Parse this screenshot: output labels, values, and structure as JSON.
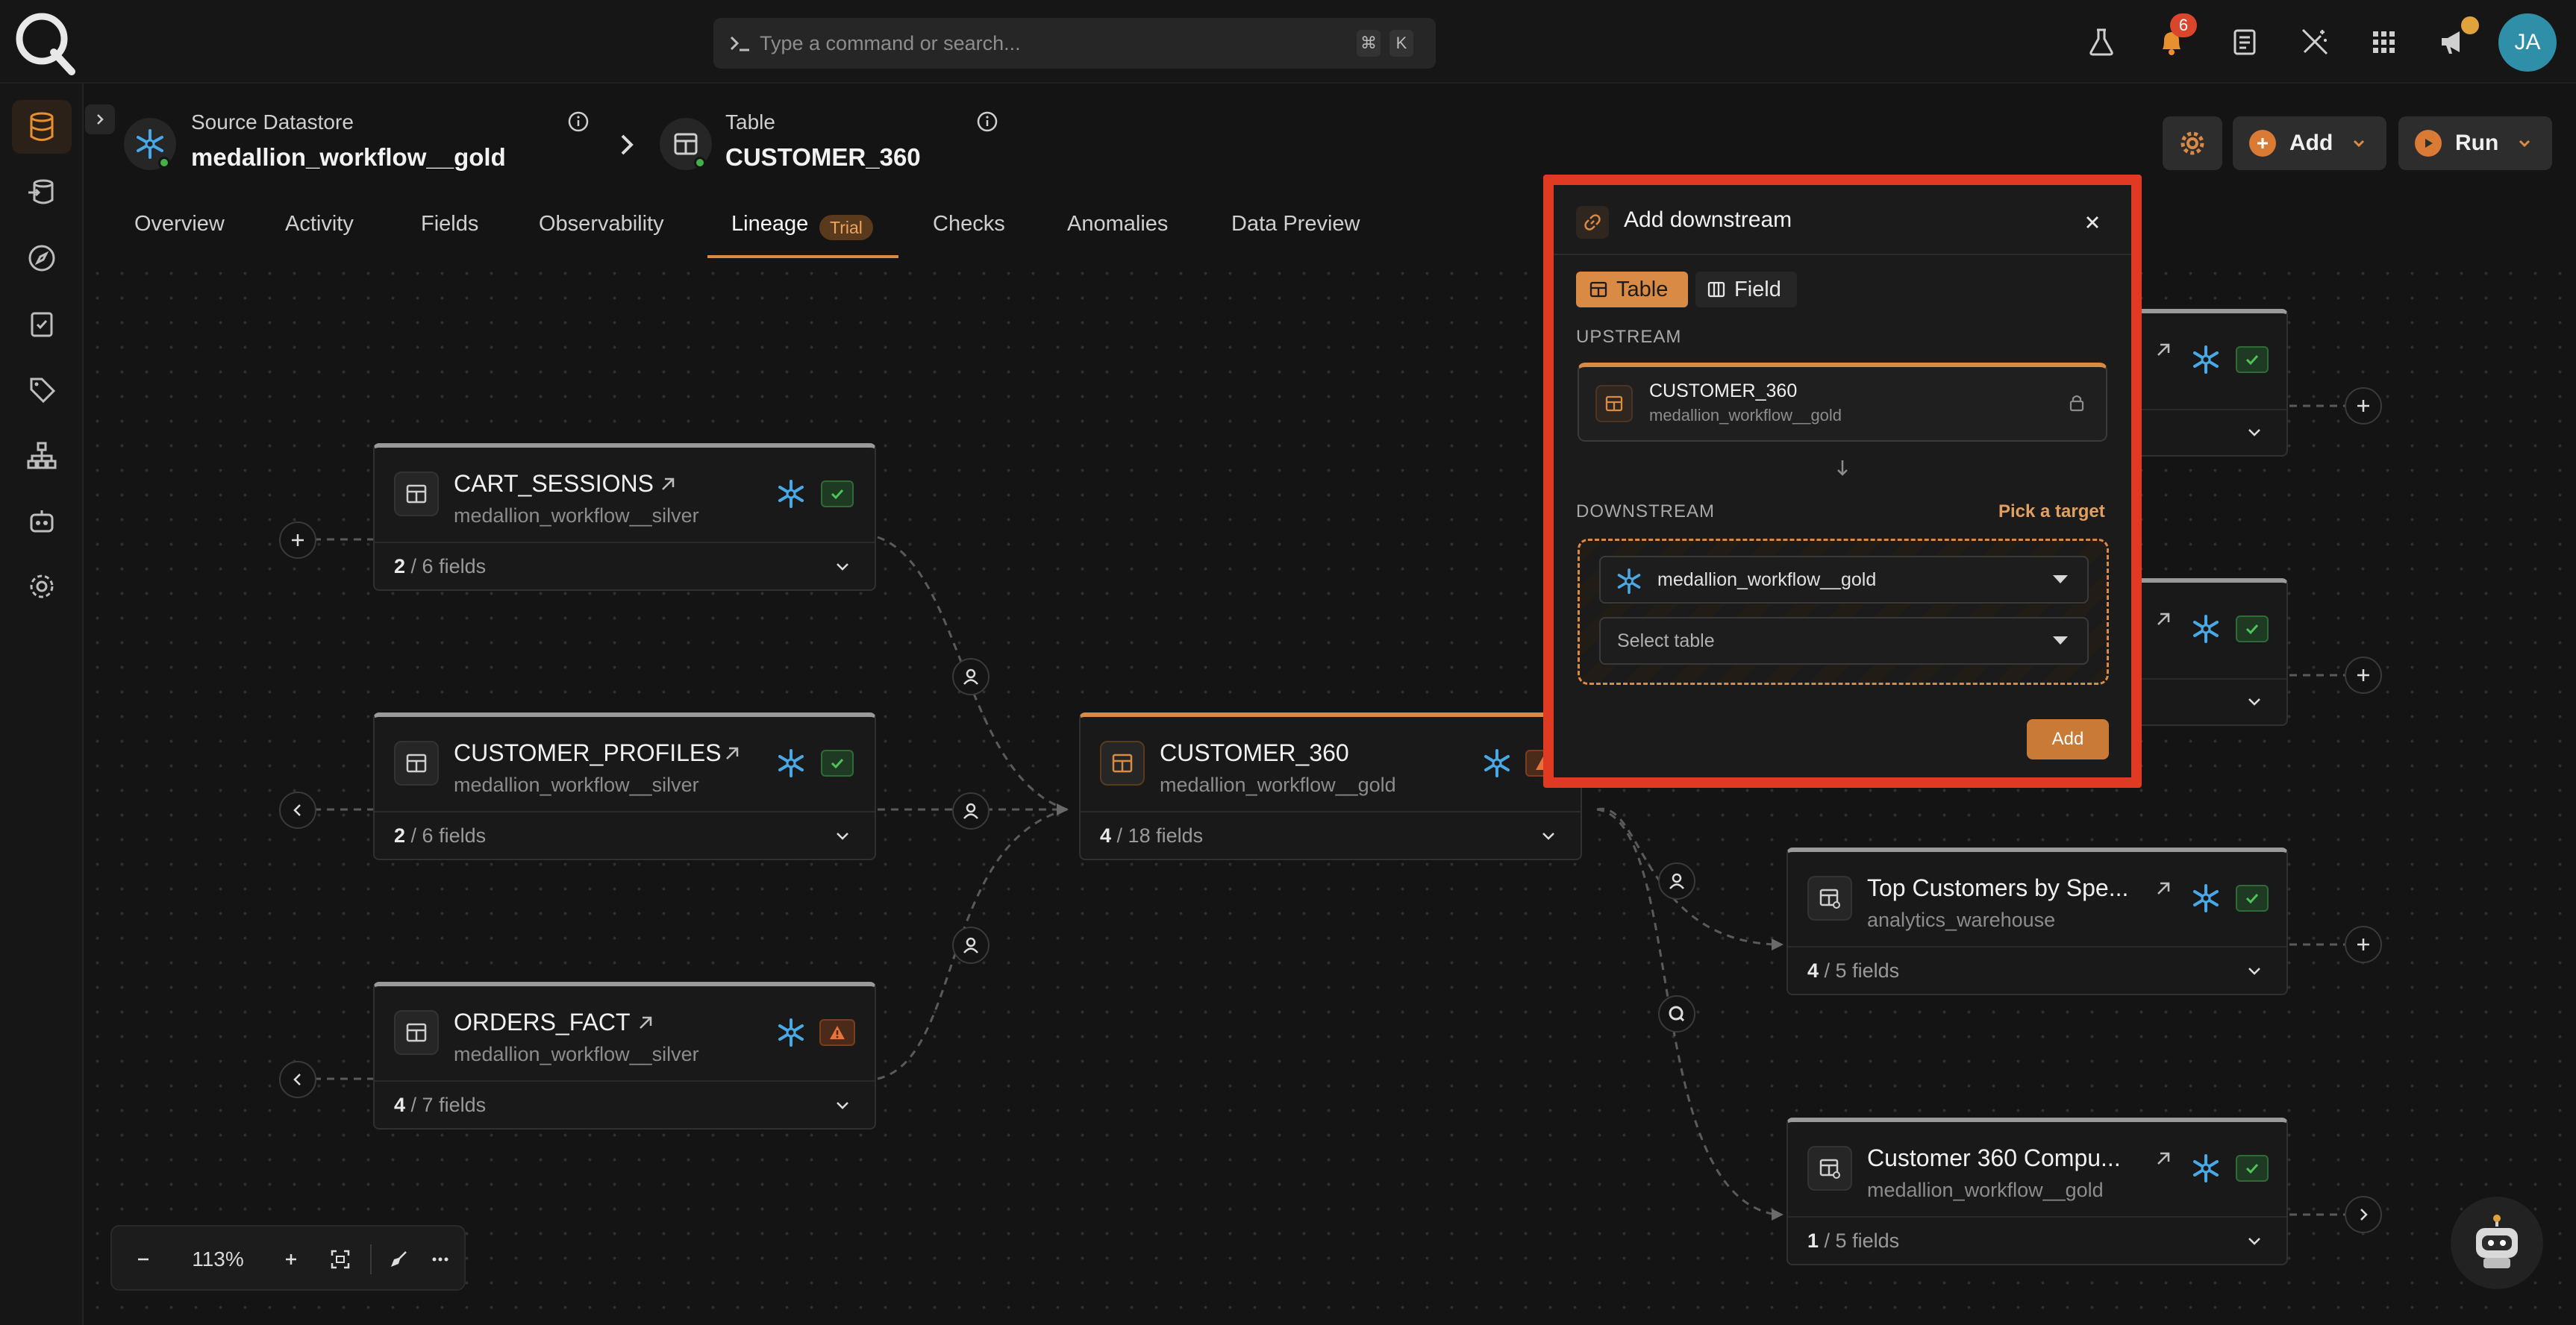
{
  "search": {
    "placeholder": "Type a command or search...",
    "kbd1": "⌘",
    "kbd2": "K"
  },
  "topbar": {
    "notification_count": "6",
    "avatar_initials": "JA"
  },
  "header": {
    "datastore_label": "Source Datastore",
    "datastore_name": "medallion_workflow__gold",
    "table_label": "Table",
    "table_name": "CUSTOMER_360",
    "settings_icon": "gear-icon",
    "add_label": "Add",
    "run_label": "Run"
  },
  "tabs": [
    {
      "label": "Overview"
    },
    {
      "label": "Activity"
    },
    {
      "label": "Fields"
    },
    {
      "label": "Observability"
    },
    {
      "label": "Lineage",
      "badge": "Trial",
      "active": true
    },
    {
      "label": "Checks"
    },
    {
      "label": "Anomalies"
    },
    {
      "label": "Data Preview"
    }
  ],
  "nodes": {
    "cart_sessions": {
      "title": "CART_SESSIONS",
      "sub": "medallion_workflow__silver",
      "fields_shown": "2",
      "fields_total": "/ 6 fields"
    },
    "customer_profiles": {
      "title": "CUSTOMER_PROFILES",
      "sub": "medallion_workflow__silver",
      "fields_shown": "2",
      "fields_total": "/ 6 fields"
    },
    "orders_fact": {
      "title": "ORDERS_FACT",
      "sub": "medallion_workflow__silver",
      "fields_shown": "4",
      "fields_total": "/ 7 fields"
    },
    "customer_360": {
      "title": "CUSTOMER_360",
      "sub": "medallion_workflow__gold",
      "fields_shown": "4",
      "fields_total": "/ 18 fields"
    },
    "top_customers": {
      "title": "Top Customers by Spe...",
      "sub": "analytics_warehouse",
      "fields_shown": "4",
      "fields_total": "/ 5 fields"
    },
    "customer_360_compu": {
      "title": "Customer 360 Compu...",
      "sub": "medallion_workflow__gold",
      "fields_shown": "1",
      "fields_total": "/ 5 fields"
    }
  },
  "zoom": {
    "level": "113%"
  },
  "modal": {
    "title": "Add downstream",
    "segment_table": "Table",
    "segment_field": "Field",
    "upstream_label": "UPSTREAM",
    "upstream_name": "CUSTOMER_360",
    "upstream_sub": "medallion_workflow__gold",
    "downstream_label": "DOWNSTREAM",
    "pick_target": "Pick a target",
    "datastore_select": "medallion_workflow__gold",
    "table_select_placeholder": "Select table",
    "add_button": "Add"
  },
  "colors": {
    "accent": "#d98a45",
    "highlight_frame": "#e03a22",
    "success": "#43b04a"
  }
}
